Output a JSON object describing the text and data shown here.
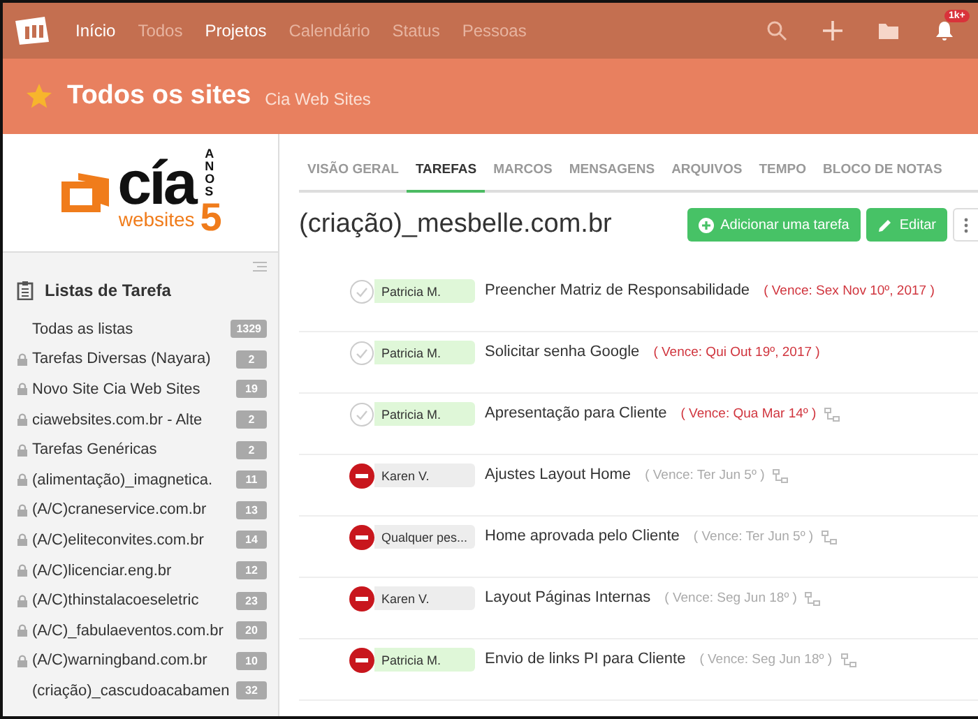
{
  "nav": {
    "items": [
      {
        "label": "Início",
        "selected": true
      },
      {
        "label": "Todos",
        "selected": false
      },
      {
        "label": "Projetos",
        "selected": true
      },
      {
        "label": "Calendário",
        "selected": false
      },
      {
        "label": "Status",
        "selected": false
      },
      {
        "label": "Pessoas",
        "selected": false
      }
    ],
    "notification_badge": "1k+"
  },
  "header": {
    "title": "Todos os sites",
    "subtitle": "Cia Web Sites"
  },
  "logo": {
    "word": "cía",
    "tagline": "websites",
    "years": "5",
    "years_label": "ANOS"
  },
  "sidebar": {
    "title": "Listas de Tarefa",
    "items": [
      {
        "label": "Todas as listas",
        "count": "1329",
        "locked": false
      },
      {
        "label": "Tarefas Diversas (Nayara)",
        "count": "2",
        "locked": true
      },
      {
        "label": "Novo Site Cia Web Sites",
        "count": "19",
        "locked": true
      },
      {
        "label": "ciawebsites.com.br - Alte",
        "count": "2",
        "locked": true
      },
      {
        "label": "Tarefas Genéricas",
        "count": "2",
        "locked": true
      },
      {
        "label": "(alimentação)_imagnetica.",
        "count": "11",
        "locked": true
      },
      {
        "label": "(A/C)craneservice.com.br",
        "count": "13",
        "locked": true
      },
      {
        "label": "(A/C)eliteconvites.com.br",
        "count": "14",
        "locked": true
      },
      {
        "label": "(A/C)licenciar.eng.br",
        "count": "12",
        "locked": true
      },
      {
        "label": "(A/C)thinstalacoeseletric",
        "count": "23",
        "locked": true
      },
      {
        "label": "(A/C)_fabulaeventos.com.br",
        "count": "20",
        "locked": true
      },
      {
        "label": "(A/C)warningband.com.br",
        "count": "10",
        "locked": true
      },
      {
        "label": "(criação)_cascudoacabamen",
        "count": "32",
        "locked": false
      }
    ]
  },
  "tabs": [
    {
      "label": "VISÃO GERAL",
      "selected": false
    },
    {
      "label": "TAREFAS",
      "selected": true
    },
    {
      "label": "MARCOS",
      "selected": false
    },
    {
      "label": "MENSAGENS",
      "selected": false
    },
    {
      "label": "ARQUIVOS",
      "selected": false
    },
    {
      "label": "TEMPO",
      "selected": false
    },
    {
      "label": "BLOCO DE NOTAS",
      "selected": false
    }
  ],
  "project_title": "(criação)_mesbelle.com.br",
  "buttons": [
    {
      "label": "Adicionar uma tarefa",
      "kind": "add"
    },
    {
      "label": "Editar",
      "kind": "edit"
    }
  ],
  "tasks": [
    {
      "kind": "open",
      "assignee": "Patricia M.",
      "color": "#dff7d8",
      "title": "Preencher Matriz de Responsabilidade",
      "due": "( Vence: Sex Nov 10º, 2017 )",
      "overdue": true,
      "has_subtasks": false
    },
    {
      "kind": "open",
      "assignee": "Patricia M.",
      "color": "#dff7d8",
      "title": "Solicitar senha Google",
      "due": "( Vence: Qui Out 19º, 2017 )",
      "overdue": true,
      "has_subtasks": false
    },
    {
      "kind": "open",
      "assignee": "Patricia M.",
      "color": "#dff7d8",
      "title": "Apresentação para Cliente",
      "due": "( Vence: Qua Mar 14º )",
      "overdue": true,
      "has_subtasks": true
    },
    {
      "kind": "blocked",
      "assignee": "Karen V.",
      "color": "#ededed",
      "title": "Ajustes Layout Home",
      "due": "( Vence: Ter Jun 5º )",
      "overdue": false,
      "has_subtasks": true
    },
    {
      "kind": "blocked",
      "assignee": "Qualquer pes...",
      "color": "#ededed",
      "title": "Home aprovada pelo Cliente",
      "due": "( Vence: Ter Jun 5º )",
      "overdue": false,
      "has_subtasks": true
    },
    {
      "kind": "blocked",
      "assignee": "Karen V.",
      "color": "#ededed",
      "title": "Layout Páginas Internas",
      "due": "( Vence: Seg Jun 18º )",
      "overdue": false,
      "has_subtasks": true
    },
    {
      "kind": "blocked",
      "assignee": "Patricia M.",
      "color": "#dff7d8",
      "title": "Envio de links PI para Cliente",
      "due": "( Vence: Seg Jun 18º )",
      "overdue": false,
      "has_subtasks": true
    }
  ]
}
